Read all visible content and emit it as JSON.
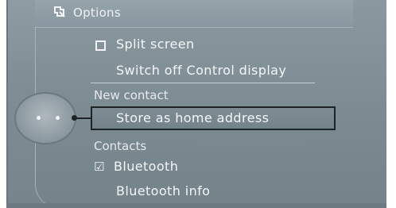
{
  "header": {
    "title": "Options",
    "icon": "options-icon"
  },
  "menu": {
    "split_screen": "Split screen",
    "switch_off_display": "Switch off Control display",
    "new_contact_section": "New contact",
    "store_home_address": "Store as home address",
    "contacts_section": "Contacts",
    "bluetooth": "Bluetooth",
    "bluetooth_info": "Bluetooth info"
  },
  "state": {
    "split_screen_checked": false,
    "bluetooth_checked": true,
    "selected_item": "Store as home address"
  },
  "colors": {
    "panel": "#7c8a92",
    "text": "#f4f6f7",
    "selection_border": "#1e2326"
  }
}
